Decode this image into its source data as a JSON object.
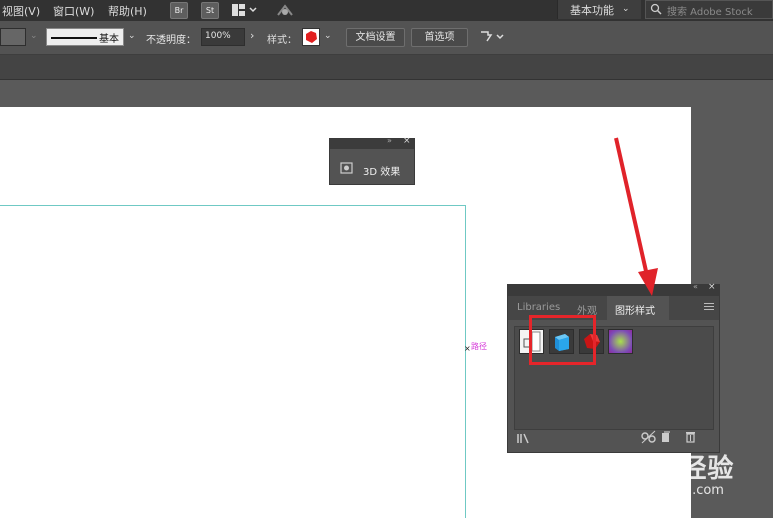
{
  "menubar": {
    "items": [
      "视图(V)",
      "窗口(W)",
      "帮助(H)"
    ],
    "bridge_buttons": [
      "Br",
      "St"
    ],
    "workspace_label": "基本功能",
    "search_placeholder": "搜索 Adobe Stock"
  },
  "control_bar": {
    "stroke_profile": "基本",
    "opacity_label": "不透明度：",
    "opacity_value": "100%",
    "style_label": "样式：",
    "doc_setup_button": "文档设置",
    "preferences_button": "首选项"
  },
  "canvas": {
    "path_label": "路径"
  },
  "panel_3d": {
    "label": "3D 效果"
  },
  "graphic_styles_panel": {
    "tabs": [
      "Libraries",
      "外观",
      "图形样式"
    ],
    "active_tab": "图形样式",
    "swatches": [
      "default-style-swatch",
      "blue-3d-style-swatch",
      "red-3d-style-swatch",
      "purple-glow-style-swatch"
    ]
  },
  "watermark": {
    "brand": "Baidu经验",
    "url": "jingyan.baidu.com"
  },
  "colors": {
    "highlight": "#e5252a",
    "arrow": "#e0232a",
    "path_guide": "#6fc9c4",
    "path_label": "#d63ad9"
  }
}
